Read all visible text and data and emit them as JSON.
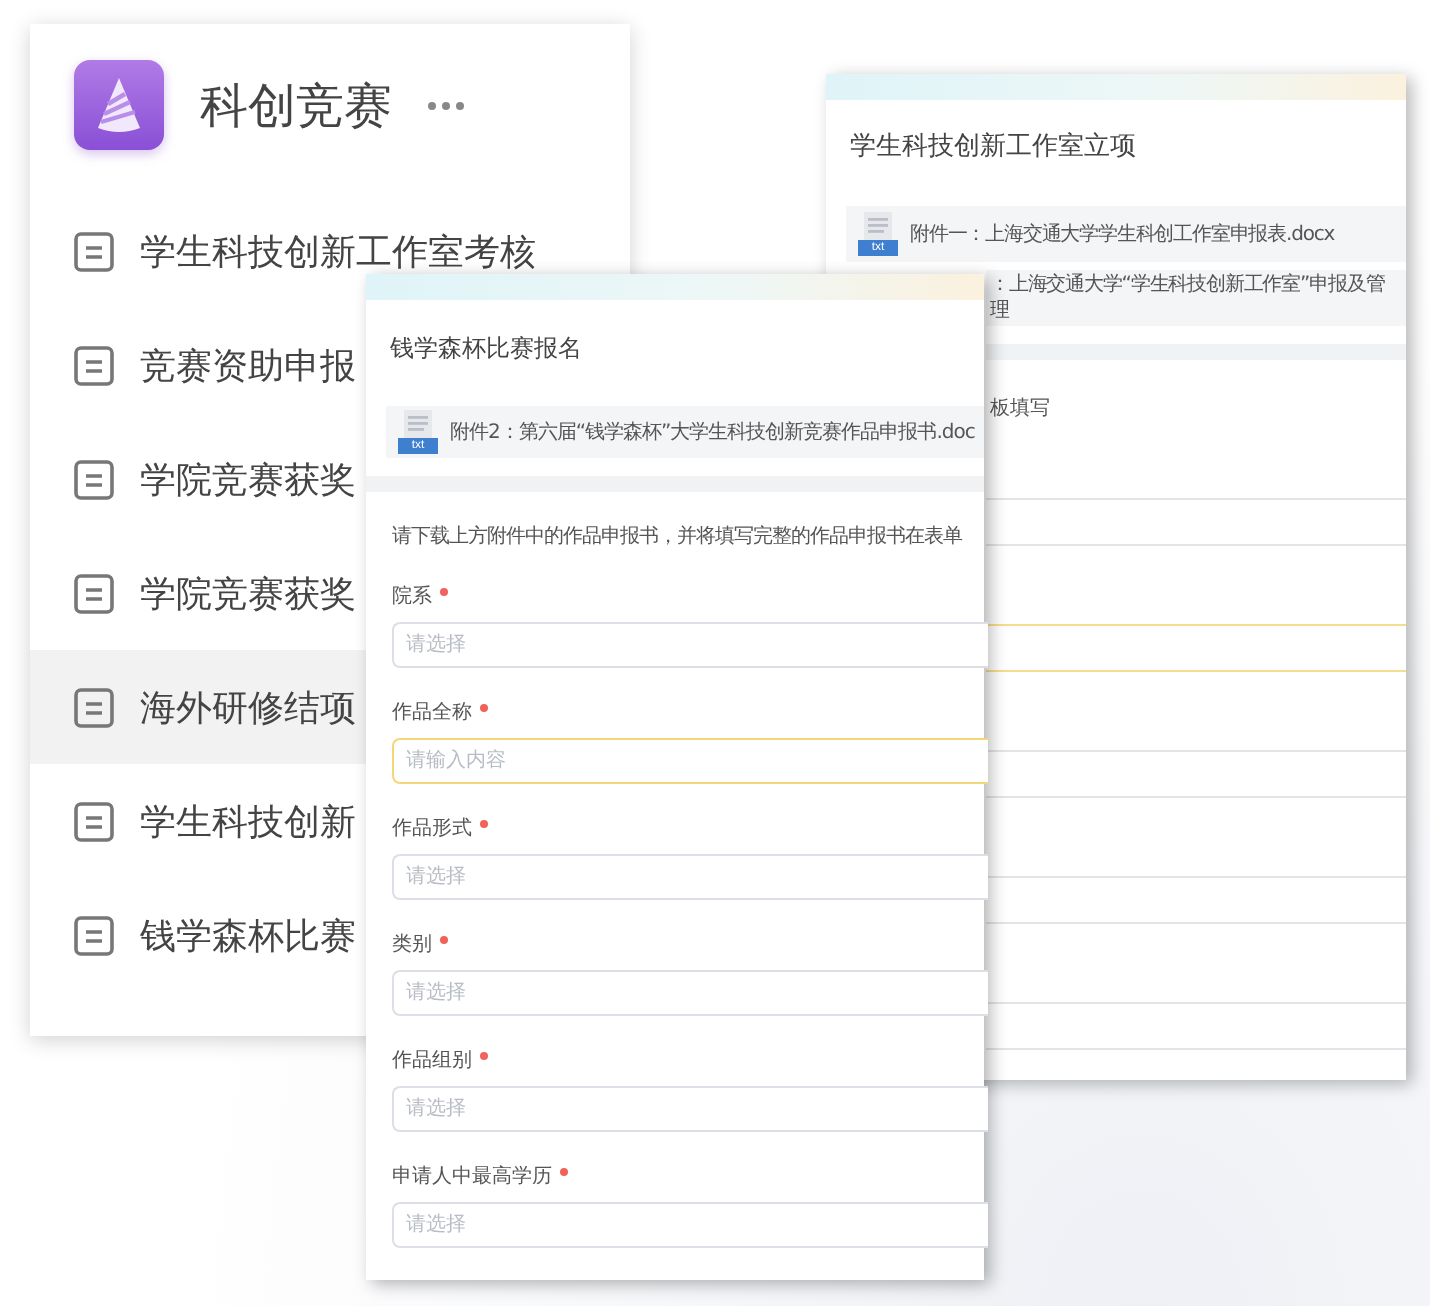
{
  "app": {
    "title": "科创竞赛",
    "items": [
      {
        "label": "学生科技创新工作室考核",
        "selected": false
      },
      {
        "label": "竞赛资助申报",
        "selected": false
      },
      {
        "label": "学院竞赛获奖",
        "selected": false
      },
      {
        "label": "学院竞赛获奖",
        "selected": false
      },
      {
        "label": "海外研修结项",
        "selected": true
      },
      {
        "label": "学生科技创新",
        "selected": false
      },
      {
        "label": "钱学森杯比赛",
        "selected": false
      }
    ]
  },
  "back_form": {
    "title": "学生科技创新工作室立项",
    "attachments": [
      {
        "badge": "txt",
        "name": "附件一：上海交通大学学生科创工作室申报表.docx"
      },
      {
        "name": "：上海交通大学“学生科技创新工作室”申报及管理"
      }
    ],
    "note": "板填写",
    "fields": [
      {
        "focused": false
      },
      {
        "focused": true
      },
      {
        "focused": false
      },
      {
        "focused": false
      },
      {
        "focused": false
      }
    ]
  },
  "front_form": {
    "title": "钱学森杯比赛报名",
    "attachments": [
      {
        "badge": "txt",
        "name": "附件2：第六届“钱学森杯”大学生科技创新竞赛作品申报书.doc"
      }
    ],
    "instruction": "请下载上方附件中的作品申报书，并将填写完整的作品申报书在表单",
    "fields": [
      {
        "label": "院系",
        "required": true,
        "placeholder": "请选择",
        "focused": false
      },
      {
        "label": "作品全称",
        "required": true,
        "placeholder": "请输入内容",
        "focused": true
      },
      {
        "label": "作品形式",
        "required": true,
        "placeholder": "请选择",
        "focused": false
      },
      {
        "label": "类别",
        "required": true,
        "placeholder": "请选择",
        "focused": false
      },
      {
        "label": "作品组别",
        "required": true,
        "placeholder": "请选择",
        "focused": false
      },
      {
        "label": "申请人中最高学历",
        "required": true,
        "placeholder": "请选择",
        "focused": false
      }
    ]
  }
}
